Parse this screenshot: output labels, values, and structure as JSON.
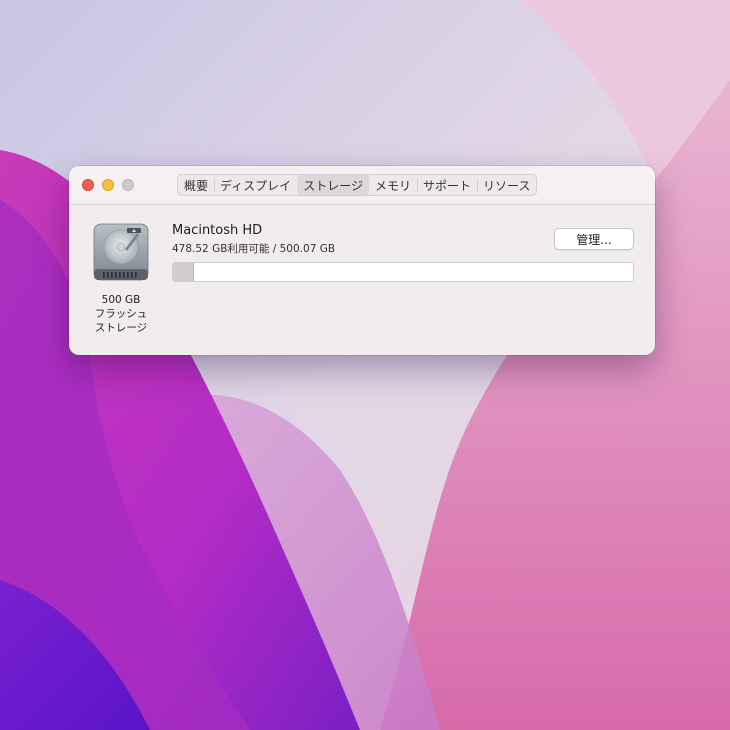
{
  "window": {
    "tabs": [
      {
        "label": "概要",
        "active": false
      },
      {
        "label": "ディスプレイ",
        "active": false
      },
      {
        "label": "ストレージ",
        "active": true
      },
      {
        "label": "メモリ",
        "active": false
      },
      {
        "label": "サポート",
        "active": false
      },
      {
        "label": "リソース",
        "active": false
      }
    ]
  },
  "disk": {
    "icon": "hard-drive-icon",
    "capacity": "500 GB",
    "type_line1": "フラッシュ",
    "type_line2": "ストレージ"
  },
  "volume": {
    "name": "Macintosh HD",
    "availability": "478.52 GB利用可能 / 500.07 GB",
    "used_fraction": 0.043,
    "manage_label": "管理..."
  },
  "colors": {
    "close": "#ec5f57",
    "minimize": "#f4be3f",
    "zoom": "#cdcacc"
  }
}
